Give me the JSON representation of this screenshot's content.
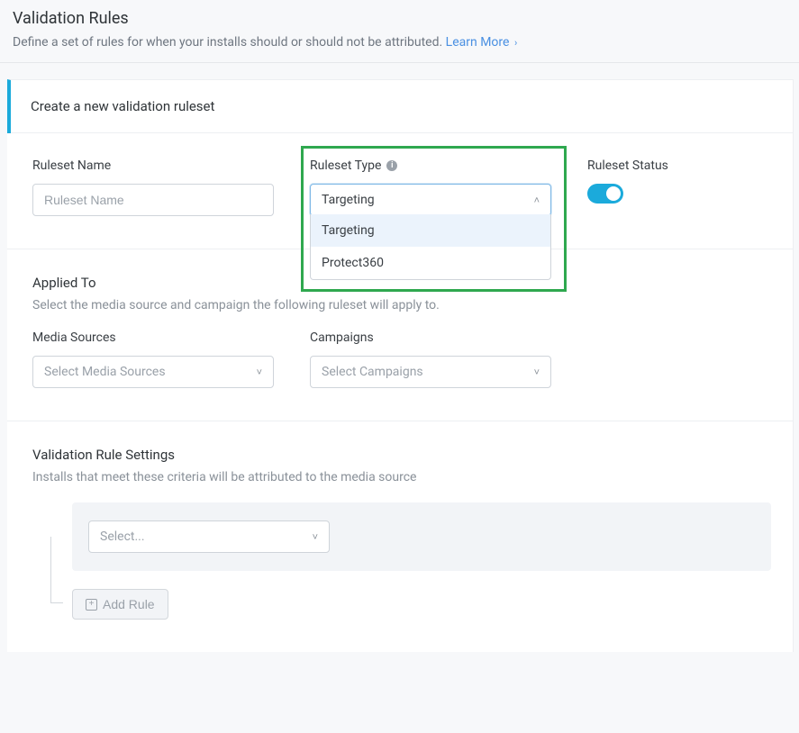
{
  "header": {
    "title": "Validation Rules",
    "subtitle": "Define a set of rules for when your installs should or should not be attributed.",
    "learn_more": "Learn More"
  },
  "card": {
    "title": "Create a new validation ruleset"
  },
  "ruleset": {
    "name_label": "Ruleset Name",
    "name_placeholder": "Ruleset Name",
    "type_label": "Ruleset Type",
    "type_value": "Targeting",
    "type_options": [
      "Targeting",
      "Protect360"
    ],
    "status_label": "Ruleset Status",
    "status_on": true
  },
  "applied": {
    "title": "Applied To",
    "desc": "Select the media source and campaign the following ruleset will apply to.",
    "media_label": "Media Sources",
    "media_placeholder": "Select Media Sources",
    "campaign_label": "Campaigns",
    "campaign_placeholder": "Select Campaigns"
  },
  "settings": {
    "title": "Validation Rule Settings",
    "desc": "Installs that meet these criteria will be attributed to the media source",
    "rule_placeholder": "Select...",
    "add_rule": "Add Rule"
  }
}
